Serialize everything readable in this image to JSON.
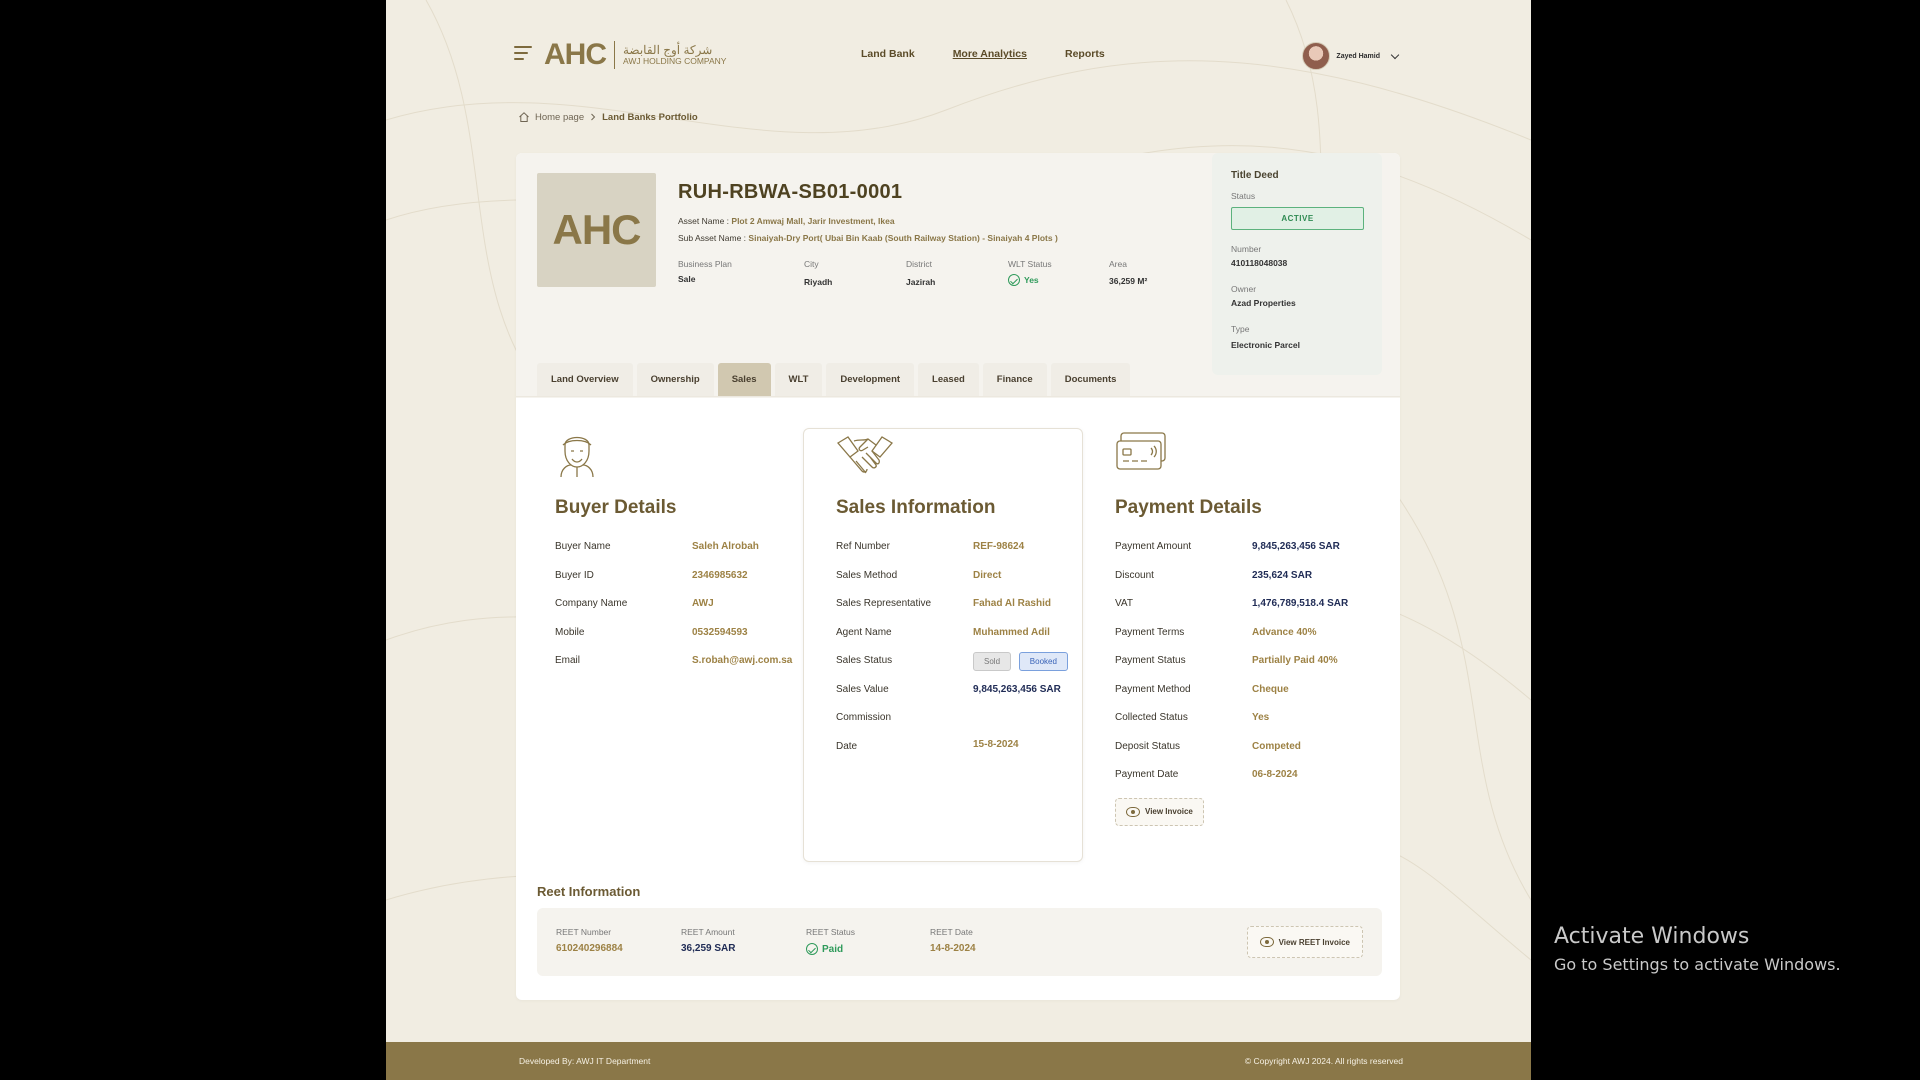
{
  "header": {
    "logo_mark": "AHC",
    "logo_arabic": "شركة أوج القابضة",
    "logo_english": "AWJ HOLDING COMPANY",
    "nav": [
      {
        "label": "Land Bank",
        "active": false
      },
      {
        "label": "More Analytics",
        "active": true
      },
      {
        "label": "Reports",
        "active": false
      }
    ],
    "user_name": "Zayed Hamid"
  },
  "breadcrumb": {
    "home": "Home page",
    "current": "Land Banks Portfolio"
  },
  "asset": {
    "logo": "AHC",
    "code": "RUH-RBWA-SB01-0001",
    "asset_name_label": "Asset Name :",
    "asset_name": "Plot 2  Amwaj Mall, Jarir Investment, Ikea",
    "sub_asset_label": "Sub Asset Name :",
    "sub_asset_name": "Sinaiyah-Dry  Port( Ubai Bin Kaab (South Railway Station) - Sinaiyah 4 Plots )",
    "meta": [
      {
        "label": "Business Plan",
        "value": "Sale"
      },
      {
        "label": "City",
        "value": "Riyadh"
      },
      {
        "label": "District",
        "value": "Jazirah"
      },
      {
        "label": "WLT Status",
        "value": "Yes"
      },
      {
        "label": "Area",
        "value": "36,259 M²"
      }
    ]
  },
  "title_deed": {
    "title": "Title Deed",
    "status_label": "Status",
    "status": "ACTIVE",
    "number_label": "Number",
    "number": "410118048038",
    "owner_label": "Owner",
    "owner": "Azad Properties",
    "type_label": "Type",
    "type": "Electronic  Parcel"
  },
  "tabs": [
    {
      "label": "Land Overview",
      "active": false
    },
    {
      "label": "Ownership",
      "active": false
    },
    {
      "label": "Sales",
      "active": true
    },
    {
      "label": "WLT",
      "active": false
    },
    {
      "label": "Development",
      "active": false
    },
    {
      "label": "Leased",
      "active": false
    },
    {
      "label": "Finance",
      "active": false
    },
    {
      "label": "Documents",
      "active": false
    }
  ],
  "buyer": {
    "title": "Buyer Details",
    "rows": [
      {
        "k": "Buyer Name",
        "v": "Saleh Alrobah"
      },
      {
        "k": "Buyer ID",
        "v": "2346985632"
      },
      {
        "k": "Company Name",
        "v": "AWJ"
      },
      {
        "k": "Mobile",
        "v": "0532594593"
      },
      {
        "k": "Email",
        "v": "S.robah@awj.com.sa"
      }
    ]
  },
  "sales": {
    "title": "Sales Information",
    "rows": [
      {
        "k": "Ref  Number",
        "v": "REF-98624"
      },
      {
        "k": "Sales Method",
        "v": "Direct"
      },
      {
        "k": "Sales Representative",
        "v": "Fahad Al Rashid"
      },
      {
        "k": "Agent Name",
        "v": "Muhammed Adil"
      }
    ],
    "status_label": "Sales Status",
    "status_options": [
      "Sold",
      "Booked"
    ],
    "status_selected": "Booked",
    "value_label": "Sales Value",
    "value": "9,845,263,456 SAR",
    "commission_label": "Commission",
    "commission": "",
    "date_label": "Date",
    "date": "15-8-2024"
  },
  "payment": {
    "title": "Payment Details",
    "rows": [
      {
        "k": "Payment Amount",
        "v": "9,845,263,456 SAR",
        "navy": true
      },
      {
        "k": "Discount",
        "v": "235,624 SAR",
        "navy": true
      },
      {
        "k": "VAT",
        "v": "1,476,789,518.4 SAR",
        "navy": true
      },
      {
        "k": "Payment Terms",
        "v": "Advance 40%",
        "navy": false
      },
      {
        "k": "Payment Status",
        "v": "Partially Paid 40%",
        "navy": false
      },
      {
        "k": "Payment Method",
        "v": "Cheque",
        "navy": false
      },
      {
        "k": "Collected Status",
        "v": "Yes",
        "navy": false
      },
      {
        "k": "Deposit Status",
        "v": "Competed",
        "navy": false
      },
      {
        "k": "Payment Date",
        "v": "06-8-2024",
        "navy": false
      }
    ],
    "view_invoice": "View Invoice"
  },
  "reet": {
    "title": "Reet Information",
    "number_label": "REET Number",
    "number": "610240296884",
    "amount_label": "REET Amount",
    "amount": "36,259 SAR",
    "status_label": "REET Status",
    "status": "Paid",
    "date_label": "REET Date",
    "date": "14-8-2024",
    "view_button": "View REET Invoice"
  },
  "footer": {
    "left": "Developed By: AWJ IT Department",
    "right": "© Copyright AWJ 2024. All rights reserved"
  },
  "os_overlay": {
    "line1": "Activate Windows",
    "line2": "Go to Settings to activate Windows."
  },
  "colors": {
    "brand": "#8a7748",
    "navy": "#1f2b55",
    "success": "#2e9a5a"
  }
}
